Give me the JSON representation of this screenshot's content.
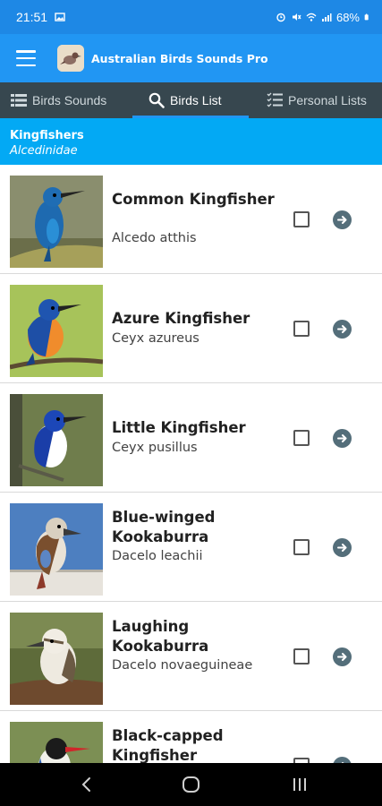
{
  "status_bar": {
    "time": "21:51",
    "battery": "68%"
  },
  "app_bar": {
    "title": "Australian Birds Sounds Pro"
  },
  "tabs": [
    {
      "label": "Birds Sounds",
      "icon": "list-icon",
      "active": false
    },
    {
      "label": "Birds List",
      "icon": "search-icon",
      "active": true
    },
    {
      "label": "Personal Lists",
      "icon": "checklist-icon",
      "active": false
    }
  ],
  "family": {
    "name": "Kingfishers",
    "latin": "Alcedinidae"
  },
  "birds": [
    {
      "name": "Common Kingfisher",
      "latin": "Alcedo atthis",
      "checked": false
    },
    {
      "name": "Azure Kingfisher",
      "latin": "Ceyx azureus",
      "checked": false
    },
    {
      "name": "Little Kingfisher",
      "latin": "Ceyx pusillus",
      "checked": false
    },
    {
      "name": "Blue-winged Kookaburra",
      "latin": "Dacelo leachii",
      "checked": false
    },
    {
      "name": "Laughing Kookaburra",
      "latin": "Dacelo novaeguineae",
      "checked": false
    },
    {
      "name": "Black-capped Kingfisher",
      "latin": "",
      "checked": false
    }
  ],
  "colors": {
    "primary": "#2196f3",
    "status_bar": "#1e88e5",
    "tab_bar": "#37474f",
    "family_header": "#03a9f4",
    "arrow_button": "#546e7a"
  }
}
